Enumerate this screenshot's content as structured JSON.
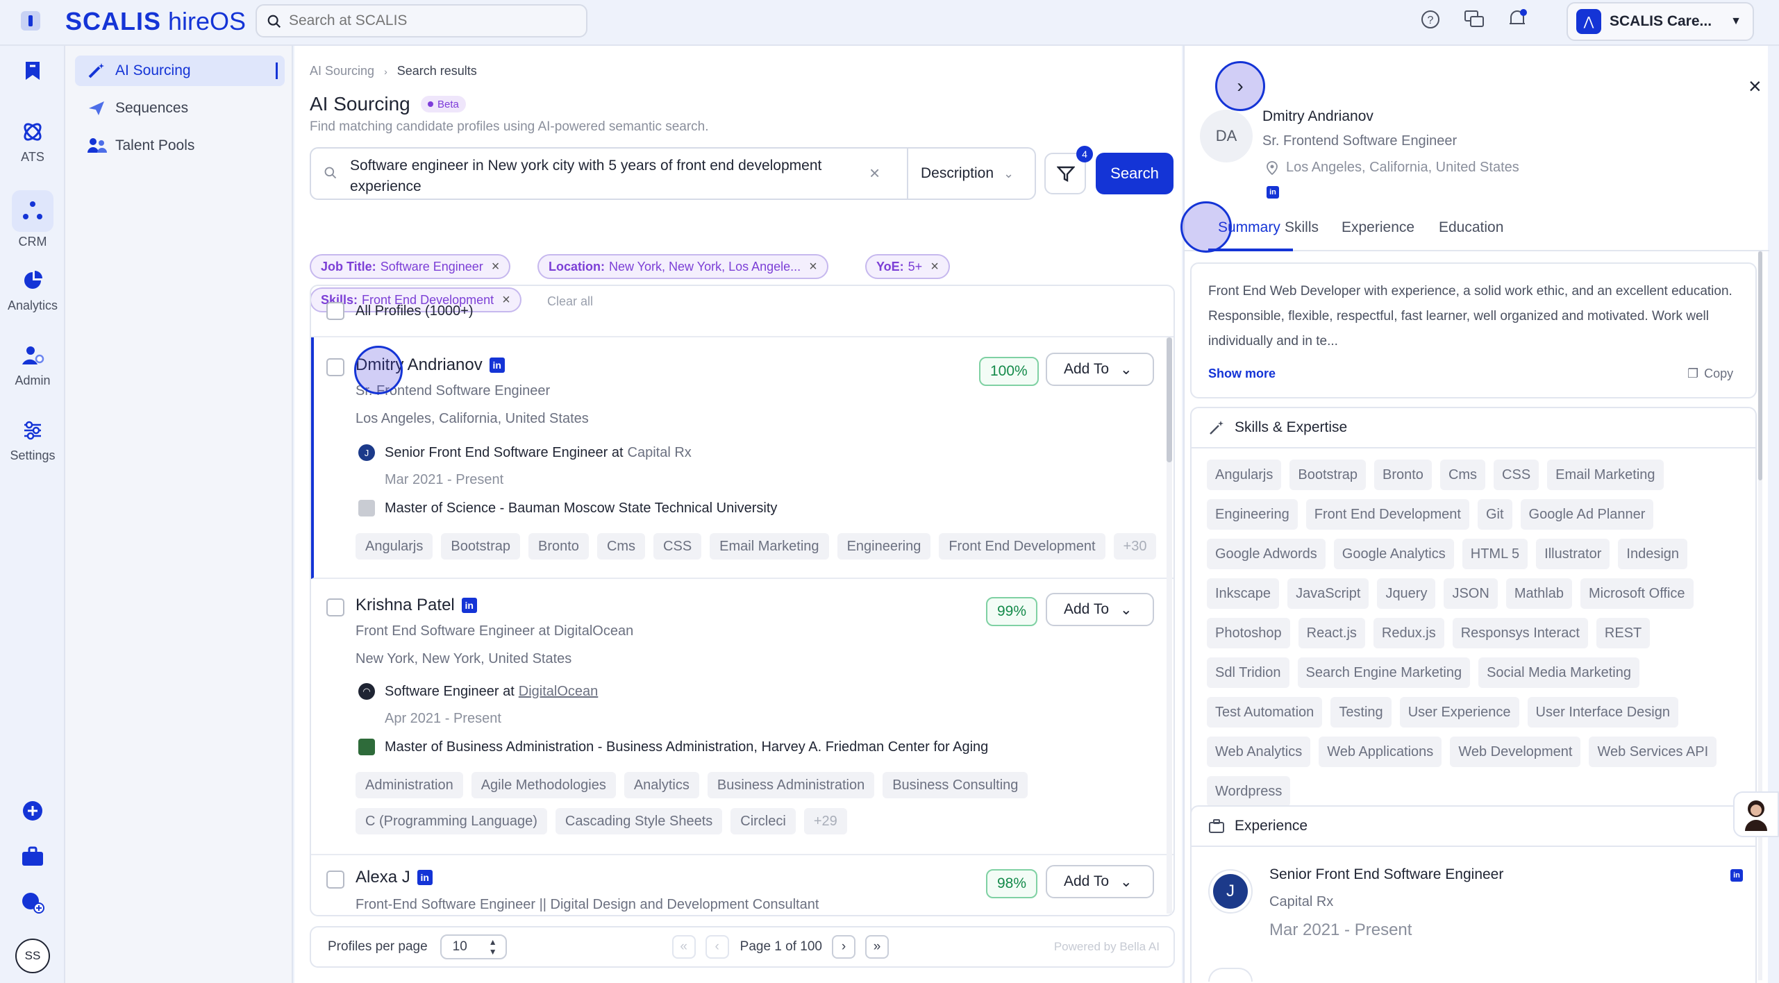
{
  "app": {
    "logo": "SCALIS",
    "product": "hireOS",
    "search_placeholder": "Search at SCALIS",
    "company": "SCALIS Care...",
    "user_initials": "SS"
  },
  "rail": [
    "ATS",
    "CRM",
    "Analytics",
    "Admin",
    "Settings"
  ],
  "nav": [
    "AI Sourcing",
    "Sequences",
    "Talent Pools"
  ],
  "main": {
    "breadcrumb": [
      "AI Sourcing",
      "Search results"
    ],
    "title": "AI Sourcing",
    "beta": "Beta",
    "subtitle": "Find matching candidate profiles using AI-powered semantic search.",
    "query": "Software engineer in New york city with 5 years of front end development experience",
    "search_type": "Description",
    "filter_count": "4",
    "search_label": "Search",
    "chips": [
      {
        "key": "Job Title:",
        "value": "Software Engineer"
      },
      {
        "key": "Location:",
        "value": "New York, New York, Los Angele..."
      },
      {
        "key": "YoE:",
        "value": "5+"
      },
      {
        "key": "Skills:",
        "value": "Front End Development"
      }
    ],
    "clear_all": "Clear all",
    "all_profiles": "All Profiles (1000+)",
    "add_to": "Add To",
    "candidates": [
      {
        "name": "Dmitry Andrianov",
        "title": "Sr. Frontend Software Engineer",
        "location": "Los Angeles, California, United States",
        "match": "100%",
        "job": "Senior Front End Software Engineer at ",
        "company": "Capital Rx",
        "dates": "Mar 2021 - Present",
        "edu": "Master of Science - Bauman Moscow State Technical University",
        "tags": [
          "Angularjs",
          "Bootstrap",
          "Bronto",
          "Cms",
          "CSS",
          "Email Marketing",
          "Engineering",
          "Front End Development"
        ],
        "more": "+30"
      },
      {
        "name": "Krishna Patel",
        "title": "Front End Software Engineer at DigitalOcean",
        "location": "New York, New York, United States",
        "match": "99%",
        "job": "Software Engineer at ",
        "company": "DigitalOcean",
        "dates": "Apr 2021 - Present",
        "edu": "Master of Business Administration - Business Administration, Harvey A. Friedman Center for Aging",
        "tags": [
          "Administration",
          "Agile Methodologies",
          "Analytics",
          "Business Administration",
          "Business Consulting"
        ],
        "tags2": [
          "C (Programming Language)",
          "Cascading Style Sheets",
          "Circleci"
        ],
        "more": "+29"
      },
      {
        "name": "Alexa J",
        "title": "Front-End Software Engineer || Digital Design and Development Consultant",
        "match": "98%"
      }
    ],
    "pager": {
      "per_page_label": "Profiles per page",
      "per_page": "10",
      "page": "Page 1 of 100",
      "powered": "Powered by Bella AI"
    }
  },
  "profile": {
    "initials": "DA",
    "name": "Dmitry Andrianov",
    "title": "Sr. Frontend Software Engineer",
    "location": "Los Angeles, California, United States",
    "tabs": [
      "Summary",
      "Skills",
      "Experience",
      "Education"
    ],
    "summary": "Front End Web Developer with experience, a solid work ethic, and an excellent education. Responsible, flexible, respectful, fast learner, well organized and motivated. Work well individually and in te...",
    "show_more": "Show more",
    "copy": "Copy",
    "skills_heading": "Skills & Expertise",
    "skills": [
      "Angularjs",
      "Bootstrap",
      "Bronto",
      "Cms",
      "CSS",
      "Email Marketing",
      "Engineering",
      "Front End Development",
      "Git",
      "Google Ad Planner",
      "Google Adwords",
      "Google Analytics",
      "HTML 5",
      "Illustrator",
      "Indesign",
      "Inkscape",
      "JavaScript",
      "Jquery",
      "JSON",
      "Mathlab",
      "Microsoft Office",
      "Photoshop",
      "React.js",
      "Redux.js",
      "Responsys Interact",
      "REST",
      "Sdl Tridion",
      "Search Engine Marketing",
      "Social Media Marketing",
      "Test Automation",
      "Testing",
      "User Experience",
      "User Interface Design",
      "Web Analytics",
      "Web Applications",
      "Web Development",
      "Web Services API",
      "Wordpress"
    ],
    "experience_heading": "Experience",
    "experience": {
      "title": "Senior Front End Software Engineer",
      "company": "Capital Rx",
      "dates": "Mar 2021 - Present"
    }
  }
}
